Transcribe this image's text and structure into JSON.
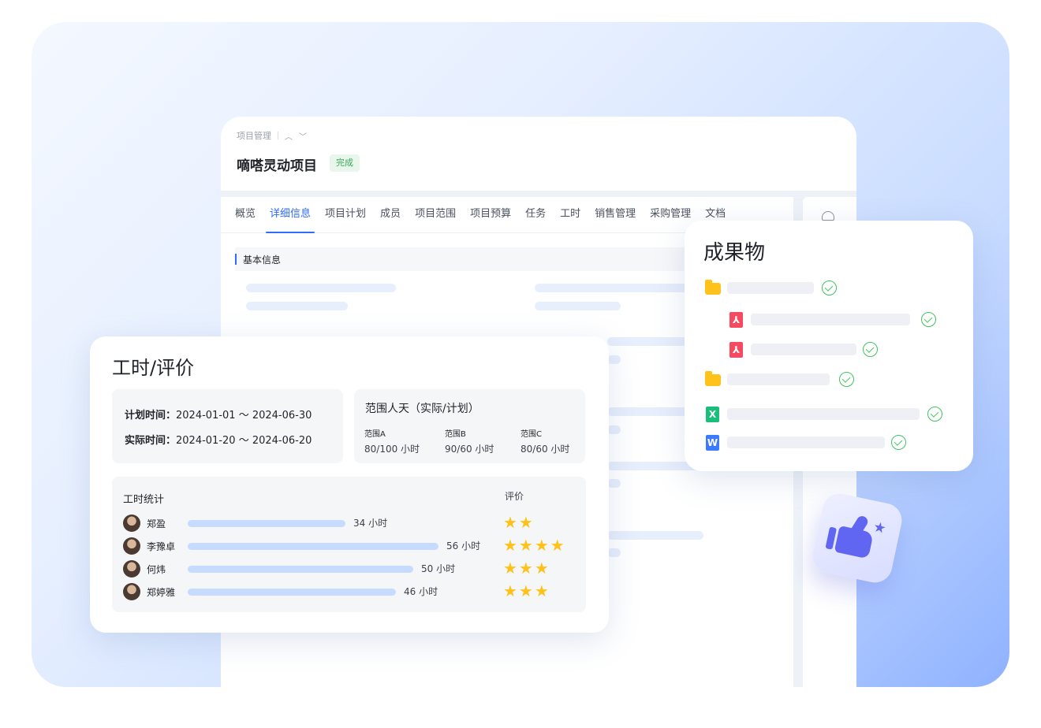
{
  "project": {
    "breadcrumb": "项目管理",
    "title": "嘀嗒灵动项目",
    "status": "完成"
  },
  "tabs": [
    "概览",
    "详细信息",
    "项目计划",
    "成员",
    "项目范围",
    "项目预算",
    "任务",
    "工时",
    "销售管理",
    "采购管理",
    "文档"
  ],
  "active_tab": "详细信息",
  "section": {
    "basic_info": "基本信息"
  },
  "work_hours": {
    "title": "工时/评价",
    "plan_label": "计划时间：",
    "plan_value": "2024-01-01 ～ 2024-06-30",
    "actual_label": "实际时间：",
    "actual_value": "2024-01-20 ～ 2024-06-20",
    "range_title": "范围人天（实际/计划）",
    "ranges": [
      {
        "name": "范围A",
        "value": "80/100 小时"
      },
      {
        "name": "范围B",
        "value": "90/60 小时"
      },
      {
        "name": "范围C",
        "value": "80/60 小时"
      }
    ],
    "stats_title": "工时统计",
    "rating_title": "评价",
    "members": [
      {
        "name": "郑盈",
        "hours_label": "34 小时",
        "hours": 34,
        "rating": 2
      },
      {
        "name": "李豫卓",
        "hours_label": "56 小时",
        "hours": 56,
        "rating": 4
      },
      {
        "name": "何炜",
        "hours_label": "50 小时",
        "hours": 50,
        "rating": 3
      },
      {
        "name": "郑婷雅",
        "hours_label": "46 小时",
        "hours": 46,
        "rating": 3
      }
    ]
  },
  "deliverables": {
    "title": "成果物",
    "items": [
      {
        "type": "folder-icon",
        "status": "done"
      },
      {
        "type": "pdf-file-icon",
        "status": "done"
      },
      {
        "type": "pdf-file-icon",
        "status": "done"
      },
      {
        "type": "folder-icon",
        "status": "done"
      },
      {
        "type": "excel-file-icon",
        "status": "done"
      },
      {
        "type": "word-file-icon",
        "status": "done"
      }
    ]
  },
  "colors": {
    "accent": "#2f6bff",
    "status_green": "#3aa757",
    "star": "#ffc21a",
    "hour_bar": "#c7dbff"
  }
}
